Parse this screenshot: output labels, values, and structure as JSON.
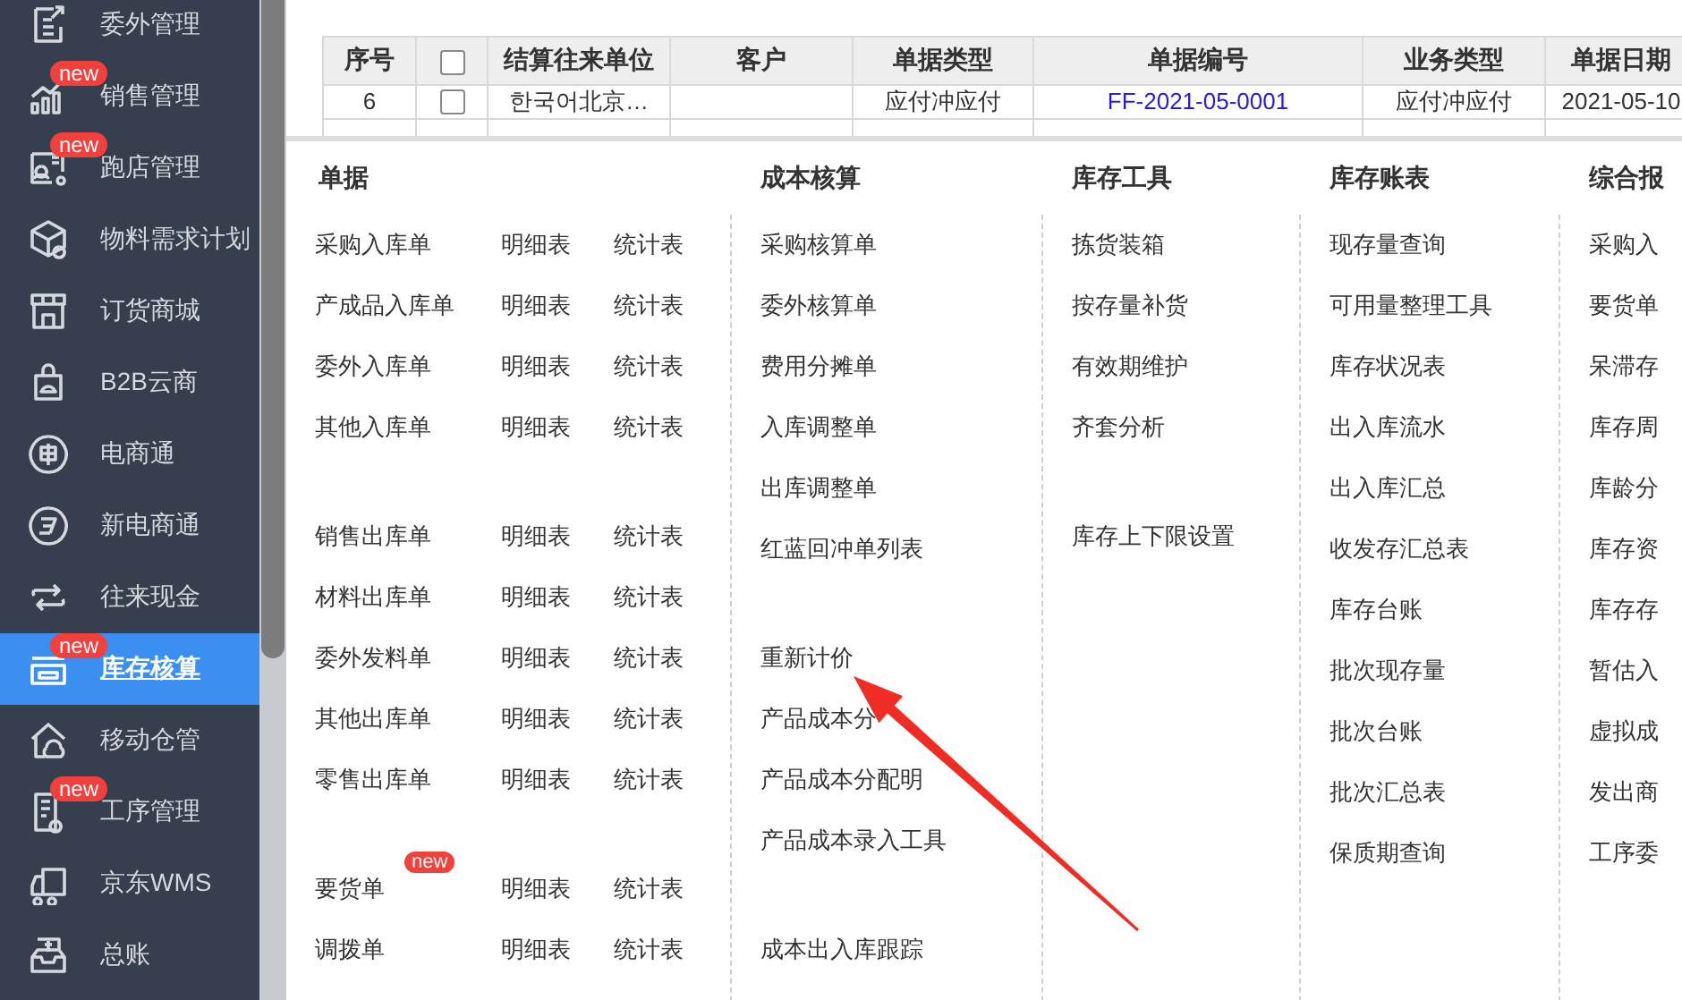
{
  "sidebar": {
    "items": [
      {
        "label": "委外管理",
        "selected": false
      },
      {
        "label": "销售管理",
        "selected": false,
        "badge": "new"
      },
      {
        "label": "跑店管理",
        "selected": false,
        "badge": "new"
      },
      {
        "label": "物料需求计划",
        "selected": false
      },
      {
        "label": "订货商城",
        "selected": false
      },
      {
        "label": "B2B云商",
        "selected": false
      },
      {
        "label": "电商通",
        "selected": false
      },
      {
        "label": "新电商通",
        "selected": false
      },
      {
        "label": "往来现金",
        "selected": false
      },
      {
        "label": "库存核算",
        "selected": true,
        "badge": "new"
      },
      {
        "label": "移动仓管",
        "selected": false
      },
      {
        "label": "工序管理",
        "selected": false,
        "badge": "new"
      },
      {
        "label": "京东WMS",
        "selected": false
      },
      {
        "label": "总账",
        "selected": false
      }
    ]
  },
  "table": {
    "columns": [
      {
        "kind": "text",
        "label": "序号"
      },
      {
        "kind": "checkbox",
        "checked": false
      },
      {
        "kind": "text",
        "label": "结算往来单位"
      },
      {
        "kind": "text",
        "label": "客户"
      },
      {
        "kind": "text",
        "label": "单据类型"
      },
      {
        "kind": "text",
        "label": "单据编号"
      },
      {
        "kind": "text",
        "label": "业务类型"
      },
      {
        "kind": "text",
        "label": "单据日期"
      }
    ],
    "rows": [
      {
        "cells": [
          {
            "kind": "text",
            "text": "6"
          },
          {
            "kind": "checkbox",
            "checked": false
          },
          {
            "kind": "text",
            "text": "한국어北京…"
          },
          {
            "kind": "text",
            "text": ""
          },
          {
            "kind": "text",
            "text": "应付冲应付"
          },
          {
            "kind": "link",
            "text": "FF-2021-05-0001"
          },
          {
            "kind": "text",
            "text": "应付冲应付"
          },
          {
            "kind": "text",
            "text": "2021-05-10"
          }
        ]
      }
    ]
  },
  "menu": {
    "columns": [
      {
        "title": "单据",
        "groups": [
          [
            {
              "label": "采购入库单",
              "links": [
                "明细表",
                "统计表"
              ]
            },
            {
              "label": "产成品入库单",
              "links": [
                "明细表",
                "统计表"
              ]
            },
            {
              "label": "委外入库单",
              "links": [
                "明细表",
                "统计表"
              ]
            },
            {
              "label": "其他入库单",
              "links": [
                "明细表",
                "统计表"
              ]
            }
          ],
          [
            {
              "label": "销售出库单",
              "links": [
                "明细表",
                "统计表"
              ]
            },
            {
              "label": "材料出库单",
              "links": [
                "明细表",
                "统计表"
              ]
            },
            {
              "label": "委外发料单",
              "links": [
                "明细表",
                "统计表"
              ]
            },
            {
              "label": "其他出库单",
              "links": [
                "明细表",
                "统计表"
              ]
            },
            {
              "label": "零售出库单",
              "links": [
                "明细表",
                "统计表"
              ]
            }
          ],
          [
            {
              "label": "要货单",
              "badge": "new",
              "links": [
                "明细表",
                "统计表"
              ]
            },
            {
              "label": "调拨单",
              "links": [
                "明细表",
                "统计表"
              ]
            }
          ]
        ]
      },
      {
        "title": "成本核算",
        "groups": [
          [
            {
              "label": "采购核算单"
            },
            {
              "label": "委外核算单"
            },
            {
              "label": "费用分摊单"
            },
            {
              "label": "入库调整单"
            },
            {
              "label": "出库调整单"
            },
            {
              "label": "红蓝回冲单列表"
            }
          ],
          [
            {
              "label": "重新计价"
            },
            {
              "label": "产品成本分"
            },
            {
              "label": "产品成本分配明"
            },
            {
              "label": "产品成本录入工具"
            }
          ],
          [
            {
              "label": "成本出入库跟踪"
            }
          ]
        ]
      },
      {
        "title": "库存工具",
        "groups": [
          [
            {
              "label": "拣货装箱"
            },
            {
              "label": "按存量补货"
            },
            {
              "label": "有效期维护"
            },
            {
              "label": "齐套分析"
            }
          ],
          [
            {
              "label": "库存上下限设置"
            }
          ]
        ]
      },
      {
        "title": "库存账表",
        "groups": [
          [
            {
              "label": "现存量查询"
            },
            {
              "label": "可用量整理工具"
            },
            {
              "label": "库存状况表"
            },
            {
              "label": "出入库流水"
            },
            {
              "label": "出入库汇总"
            },
            {
              "label": "收发存汇总表"
            },
            {
              "label": "库存台账"
            },
            {
              "label": "批次现存量"
            },
            {
              "label": "批次台账"
            },
            {
              "label": "批次汇总表"
            },
            {
              "label": "保质期查询"
            }
          ]
        ]
      },
      {
        "title": "综合报",
        "groups": [
          [
            {
              "label": "采购入"
            },
            {
              "label": "要货单"
            },
            {
              "label": "呆滞存"
            },
            {
              "label": "库存周"
            },
            {
              "label": "库龄分"
            },
            {
              "label": "库存资"
            },
            {
              "label": "库存存"
            },
            {
              "label": "暂估入"
            },
            {
              "label": "虚拟成"
            },
            {
              "label": "发出商"
            },
            {
              "label": "工序委"
            }
          ]
        ]
      }
    ]
  }
}
